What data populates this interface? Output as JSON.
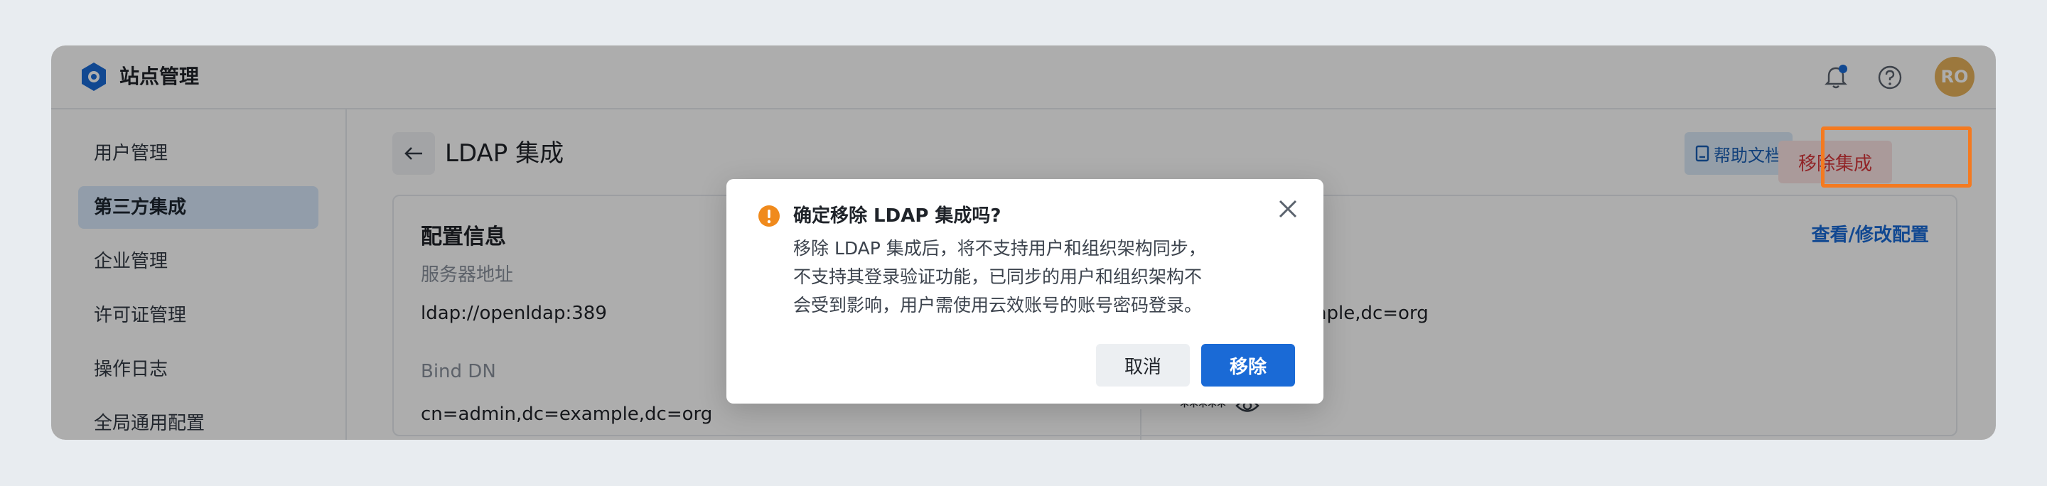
{
  "app": {
    "title": "站点管理",
    "avatar_initials": "RO",
    "accent": "#1a6ad6",
    "danger": "#d6363a",
    "avatar_color": "#e6b25a"
  },
  "sidebar": {
    "items": [
      {
        "label": "用户管理",
        "active": false
      },
      {
        "label": "第三方集成",
        "active": true
      },
      {
        "label": "企业管理",
        "active": false
      },
      {
        "label": "许可证管理",
        "active": false
      },
      {
        "label": "操作日志",
        "active": false
      },
      {
        "label": "全局通用配置",
        "active": false
      }
    ]
  },
  "page": {
    "title": "LDAP 集成",
    "help_doc_label": "帮助文档",
    "remove_label": "移除集成",
    "card": {
      "title": "配置信息",
      "edit_link": "查看/修改配置",
      "fields": [
        {
          "label": "服务器地址",
          "value": "ldap://openldap:389"
        },
        {
          "label": "Bind DN",
          "value": "cn=admin,dc=example,dc=org"
        },
        {
          "label": "",
          "value": "nple,dc=org"
        },
        {
          "label": "",
          "value": "*****"
        }
      ]
    }
  },
  "dialog": {
    "title": "确定移除 LDAP 集成吗?",
    "body_lines": [
      "移除 LDAP 集成后，将不支持用户和组织架构同步，",
      "不支持其登录验证功能，已同步的用户和组织架构不",
      "会受到影响，用户需使用云效账号的账号密码登录。"
    ],
    "cancel_label": "取消",
    "confirm_label": "移除"
  },
  "icons": {
    "logo": "hexagon-logo-icon",
    "bell": "bell-icon",
    "help": "help-circle-icon",
    "back": "arrow-left-icon",
    "doc": "document-icon",
    "eye": "eye-icon",
    "warning": "warning-icon",
    "close": "close-icon"
  }
}
